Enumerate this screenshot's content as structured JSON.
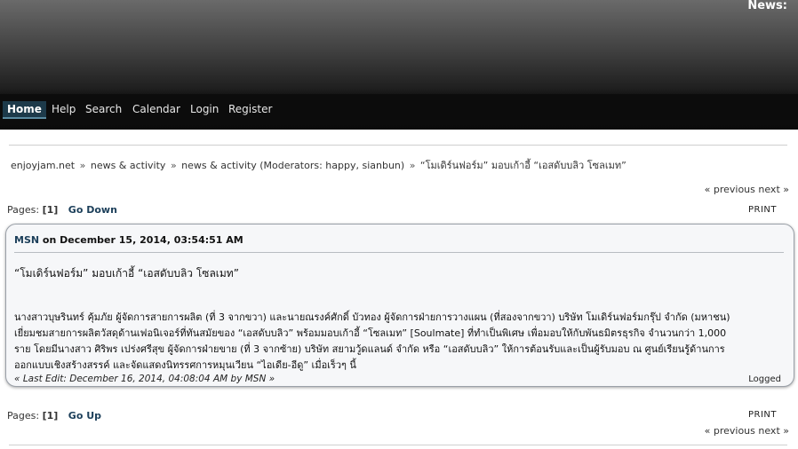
{
  "header": {
    "news_label": "News:"
  },
  "nav": {
    "items": [
      {
        "label": "Home",
        "active": true
      },
      {
        "label": "Help"
      },
      {
        "label": "Search"
      },
      {
        "label": "Calendar"
      },
      {
        "label": "Login"
      },
      {
        "label": "Register"
      }
    ]
  },
  "breadcrumb": {
    "site": "enjoyjam.net",
    "board": "news & activity",
    "board_mod": "news & activity",
    "moderators": "(Moderators: happy, sianbun)",
    "topic": "“โมเดิร์นฟอร์ม” มอบเก้าอี้ “เอสดับบลิว โซลเมท”",
    "separator": "»"
  },
  "nav_top": {
    "previous": "« previous",
    "next": "next »"
  },
  "pages_top": {
    "label": "Pages:",
    "current": "[1]",
    "go": "Go Down",
    "print": "PRINT"
  },
  "post": {
    "author": "MSN",
    "date_text": "on December 15, 2014, 03:54:51 AM",
    "title": "“โมเดิร์นฟอร์ม” มอบเก้าอี้ “เอสดับบลิว โซลเมท”",
    "body_lines": [
      "นางสาวบุษรินทร์ คุ้มภัย ผู้จัดการสายการผลิต (ที่ 3 จากขวา) และนายณรงค์ศักดิ์ บัวทอง ผู้จัดการฝ่ายการวางแผน (ที่สองจากขวา) บริษัท โมเดิร์นฟอร์มกรุ๊ป จำกัด (มหาชน)",
      "เยี่ยมชมสายการผลิตวัสดุด้านเฟอนิเจอร์ที่ทันสมัยของ “เอสดับบลิว”  พร้อมมอบเก้าอี้ “โซลเมท” [Soulmate] ที่ทำเป็นพิเศษ เพื่อมอบให้กับพันธมิตรธุรกิจ จำนวนกว่า 1,000",
      "ราย โดยมีนางสาว ศิริพร เปร่งศรีสุข ผู้จัดการฝ่ายขาย (ที่ 3 จากซ้าย) บริษัท สยามวู้ดแลนด์ จำกัด หรือ “เอสดับบลิว” ให้การต้อนรับและเป็นผู้รับมอบ ณ ศูนย์เรียนรู้ด้านการ",
      "ออกแบบเชิงสร้างสรรค์ และจัดแสดงนิทรรศการหมุนเวียน “ไอเดีย-อีดู” เมื่อเร็วๆ นี้"
    ],
    "last_edit": "« Last Edit: December 16, 2014, 04:08:04 AM by MSN »",
    "logged": "Logged"
  },
  "pages_bottom": {
    "label": "Pages:",
    "current": "[1]",
    "go": "Go Up",
    "print": "PRINT"
  },
  "nav_bottom": {
    "previous": "« previous",
    "next": "next »"
  }
}
